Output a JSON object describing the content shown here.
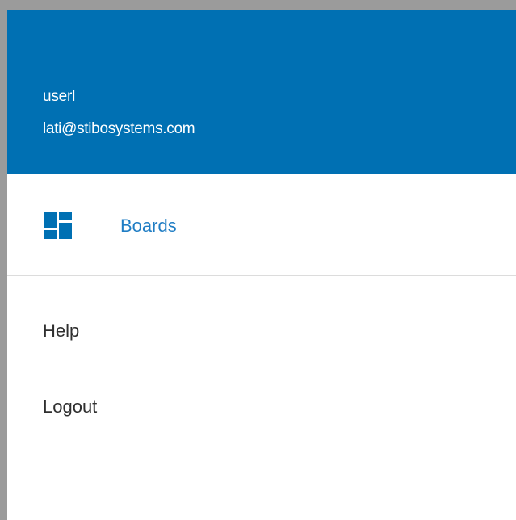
{
  "user": {
    "name": "userl",
    "email": "lati@stibosystems.com"
  },
  "nav": {
    "boards": {
      "label": "Boards",
      "icon": "dashboard-tiles-icon"
    }
  },
  "menu": {
    "help_label": "Help",
    "logout_label": "Logout"
  },
  "colors": {
    "header_bg": "#0070b3",
    "accent": "#1f7dc4",
    "text": "#2f2f2f",
    "frame": "#9b9b9b",
    "divider": "#dcdcdc"
  }
}
